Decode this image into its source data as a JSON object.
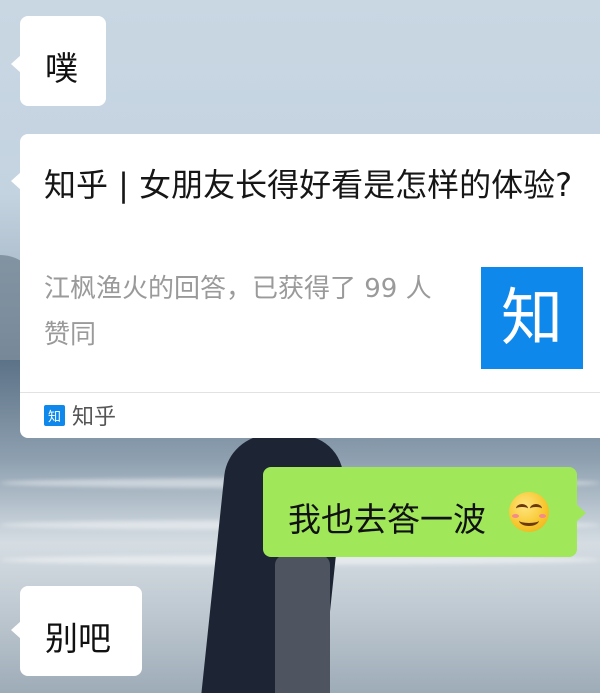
{
  "messages": [
    {
      "side": "left",
      "text": "噗"
    },
    {
      "side": "left",
      "type": "link-card",
      "title": "知乎 | 女朋友长得好看是怎样的体验?",
      "description": "江枫渔火的回答，已获得了 99 人赞同",
      "thumbnail_text": "知",
      "source_icon_text": "知",
      "source_name": "知乎"
    },
    {
      "side": "right",
      "text": "我也去答一波",
      "emoji": "smirk-emoji"
    },
    {
      "side": "left",
      "text": "别吧"
    }
  ],
  "colors": {
    "incoming_bubble": "#ffffff",
    "outgoing_bubble": "#a0e75a",
    "zhihu_blue": "#0f88eb"
  }
}
